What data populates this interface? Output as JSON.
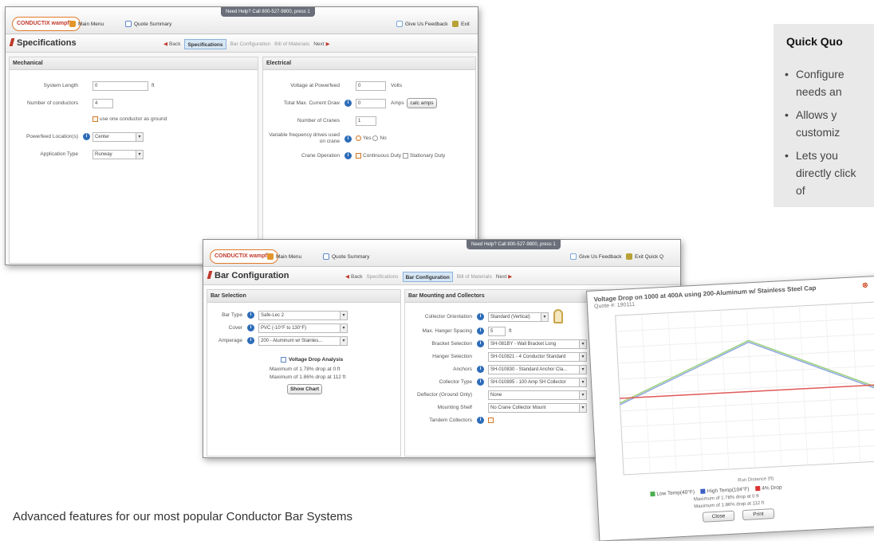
{
  "specs_window": {
    "help_banner": "Need Help? Call 800-527-9800, press 1",
    "logo": "CONDUCTIX wampfler",
    "main_menu": "Main Menu",
    "quote_summary": "Quote Summary",
    "feedback": "Give Us Feedback",
    "exit": "Exit",
    "page_title": "Specifications",
    "steps": {
      "back": "Back",
      "s1": "Specifications",
      "s2": "Bar Configuration",
      "s3": "Bill of Materials",
      "next": "Next"
    },
    "mechanical": {
      "header": "Mechanical",
      "system_length_label": "System Length",
      "system_length_value": "0",
      "system_length_unit": "ft",
      "num_conductors_label": "Number of conductors",
      "num_conductors_value": "4",
      "ground_checkbox": "use one conductor as ground",
      "powerfeed_label": "Powerfeed Location(s)",
      "powerfeed_value": "Center",
      "application_label": "Application Type",
      "application_value": "Runway"
    },
    "electrical": {
      "header": "Electrical",
      "voltage_label": "Voltage at Powerfeed",
      "voltage_value": "0",
      "voltage_unit": "Volts",
      "current_label": "Total Max. Current Draw",
      "current_value": "0",
      "current_unit": "Amps",
      "calc_button": "calc amps",
      "cranes_label": "Number of Cranes",
      "cranes_value": "1",
      "vfd_label": "Variable frequency drives used on crane",
      "vfd_yes": "Yes",
      "vfd_no": "No",
      "crane_op_label": "Crane Operation",
      "crane_op_opt1": "Continuous Duty",
      "crane_op_opt2": "Stationary Duty"
    }
  },
  "bar_window": {
    "help_banner": "Need Help? Call 800-527-9800, press 1",
    "logo": "CONDUCTIX wampfler",
    "main_menu": "Main Menu",
    "quote_summary": "Quote Summary",
    "feedback": "Give Us Feedback",
    "exit": "Exit Quick Q",
    "page_title": "Bar Configuration",
    "steps": {
      "back": "Back",
      "s1": "Specifications",
      "s2": "Bar Configuration",
      "s3": "Bill of Materials",
      "next": "Next"
    },
    "bar_selection": {
      "header": "Bar Selection",
      "bar_type_label": "Bar Type",
      "bar_type_value": "Safe-Lec 2",
      "cover_label": "Cover",
      "cover_value": "PVC (-10°F to 130°F)",
      "amperage_label": "Amperage",
      "amperage_value": "200 - Aluminum w/ Stainles...",
      "analysis_title": "Voltage Drop Analysis",
      "analysis_line1": "Maximum of 1.78% drop at 0 ft",
      "analysis_line2": "Maximum of 1.86% drop at 112 ft",
      "show_chart": "Show Chart"
    },
    "mounting": {
      "header": "Bar Mounting and Collectors",
      "orientation_label": "Collector Orientation",
      "orientation_value": "Standard (Vertical)",
      "hanger_spacing_label": "Max. Hanger Spacing",
      "hanger_spacing_value": "5",
      "hanger_spacing_unit": "ft",
      "bracket_label": "Bracket Selection",
      "bracket_value": "SH-081BY - Wall Bracket Long",
      "hanger_sel_label": "Hanger Selection",
      "hanger_sel_value": "SH-010821 - 4 Conductor Standard",
      "anchors_label": "Anchors",
      "anchors_value": "SH-010830 - Standard Anchor Cla...",
      "collector_type_label": "Collector Type",
      "collector_type_value": "SH-010895 - 100 Amp SH Collector",
      "deflector_label": "Deflector (Ground Only)",
      "deflector_value": "None",
      "mounting_shelf_label": "Mounting Shelf",
      "mounting_shelf_value": "No Crane Collector Mount",
      "tandem_label": "Tandem Collectors"
    }
  },
  "chart_window": {
    "title": "Voltage Drop on 1000 at 400A using 200-Aluminum w/ Stainless Steel Cap",
    "subtitle": "Quote #: 190111",
    "x_label": "Run Distance (ft)",
    "legend_low": "Low Temp(40°F)",
    "legend_high": "High Temp(104°F)",
    "legend_limit": "4% Drop",
    "note1": "Maximum of 1.78% drop at 0 ft",
    "note2": "Maximum of 1.86% drop at 112 ft",
    "close": "Close",
    "print": "Print"
  },
  "chart_data": {
    "type": "line",
    "title": "Voltage Drop on 1000 at 400A using 200-Aluminum w/ Stainless Steel Cap",
    "xlabel": "Run Distance (ft)",
    "ylabel": "",
    "x": [
      0,
      500,
      1000
    ],
    "series": [
      {
        "name": "Low Temp(40°F)",
        "color": "#9bd17a",
        "values": [
          450,
          800,
          450
        ]
      },
      {
        "name": "High Temp(104°F)",
        "color": "#8fa8e0",
        "values": [
          440,
          790,
          440
        ]
      },
      {
        "name": "4% Drop",
        "color": "#e05a5a",
        "values": [
          480,
          480,
          480
        ]
      }
    ],
    "ylim": [
      0,
      1000
    ],
    "grid": true
  },
  "quick_quote": {
    "title": "Quick Quo",
    "bullets": [
      "Configure needs an",
      "Allows y customiz",
      "Lets you directly click of"
    ]
  },
  "footer": "Advanced features for our most popular Conductor Bar Systems"
}
